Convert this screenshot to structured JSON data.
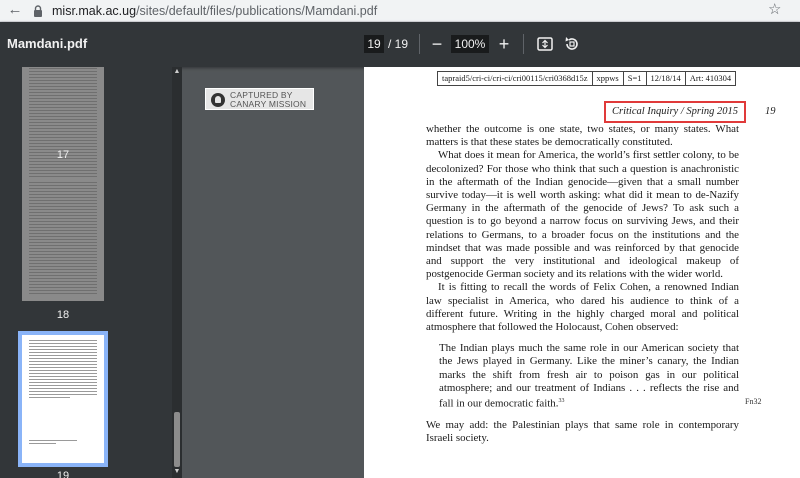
{
  "browser": {
    "url_host": "misr.mak.ac.ug",
    "url_path": "/sites/default/files/publications/Mamdani.pdf"
  },
  "toolbar": {
    "title": "Mamdani.pdf",
    "current_page": "19",
    "total_pages": "/ 19",
    "zoom": "100%",
    "zoom_out": "−",
    "zoom_in": "+"
  },
  "sidebar": {
    "thumbnails": [
      {
        "number": "17"
      },
      {
        "number": "18"
      },
      {
        "number": "19",
        "selected": true
      }
    ]
  },
  "badge": {
    "line1": "CAPTURED BY",
    "line2": "CANARY MISSION"
  },
  "page": {
    "meta_cells": [
      "tapraid5/cri-ci/cri-ci/cri00115/cri0368d15z",
      "xppws",
      "S=1",
      "12/18/14",
      "Art: 410304"
    ],
    "running_head": "Critical Inquiry  /  Spring 2015",
    "page_number": "19",
    "paragraphs": [
      "whether the outcome is one state, two states, or many states. What matters is that these states be democratically constituted.",
      "What does it mean for America, the world’s first settler colony, to be decolonized? For those who think that such a question is anachronistic in the aftermath of the Indian genocide—given that a small number survive today—it is well worth asking: what did it mean to de-Nazify Germany in the aftermath of the genocide of Jews? To ask such a question is to go beyond a narrow focus on surviving Jews, and their relations to Germans, to a broader focus on the institutions and the mindset that was made possible and was reinforced by that genocide and support the very institutional and ideological makeup of postgenocide German society and its relations with the wider world.",
      "It is fitting to recall the words of Felix Cohen, a renowned Indian law specialist in America, who dared his audience to think of a different future. Writing in the highly charged moral and political atmosphere that followed the Holocaust, Cohen observed:"
    ],
    "quote": "The Indian plays much the same role in our American society that the Jews played in Germany. Like the miner’s canary, the Indian marks the shift from fresh air to poison gas in our political atmosphere; and our treatment of Indians . . . reflects the rise and fall in our democratic faith.",
    "quote_footnote": "33",
    "final": "We may add: the Palestinian plays that same role in contemporary Israeli society.",
    "margin_note": "Fn32"
  }
}
